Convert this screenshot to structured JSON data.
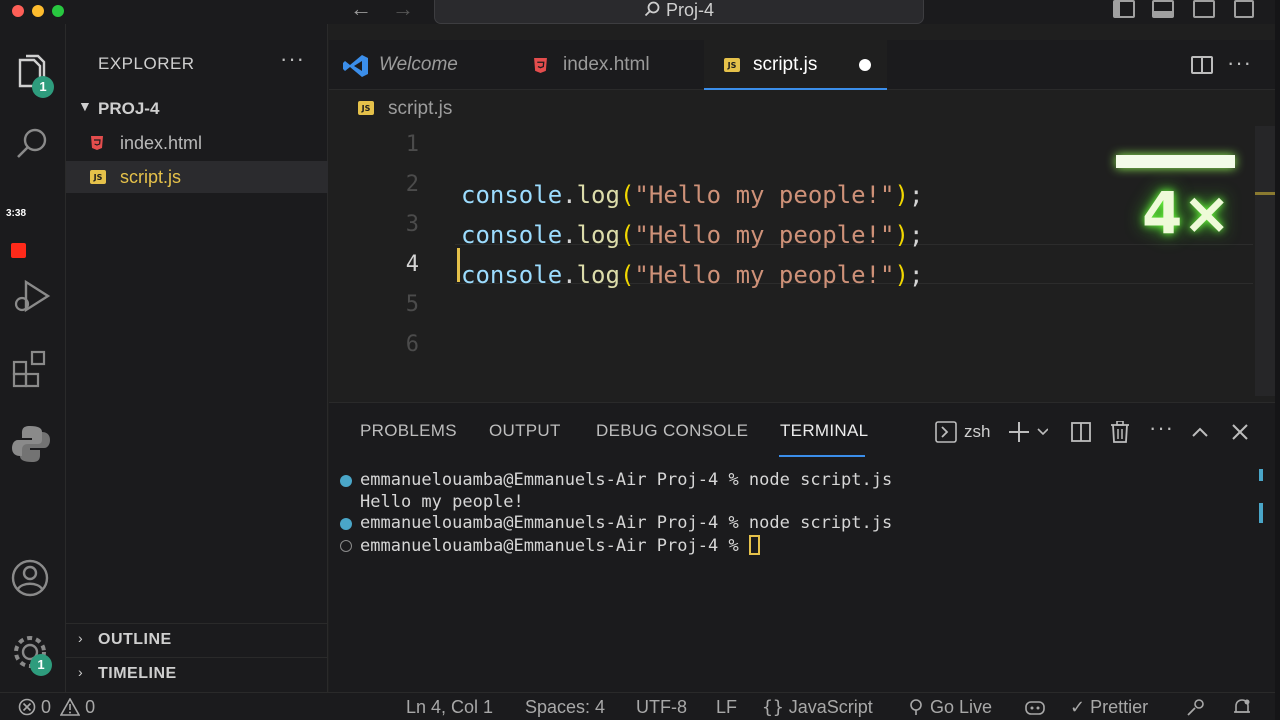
{
  "window": {
    "search_label": "Proj-4"
  },
  "activity_bar": {
    "explorer_badge": "1",
    "timer": "3:38",
    "settings_badge": "1"
  },
  "sidebar": {
    "title": "EXPLORER",
    "more": "···",
    "folder": "PROJ-4",
    "files": [
      {
        "name": "index.html",
        "type": "html"
      },
      {
        "name": "script.js",
        "type": "js"
      }
    ],
    "sections": [
      "OUTLINE",
      "TIMELINE"
    ]
  },
  "tabs": [
    {
      "label": "Welcome",
      "icon": "vscode-icon"
    },
    {
      "label": "index.html",
      "icon": "html-icon"
    },
    {
      "label": "script.js",
      "icon": "js-icon",
      "dirty": true
    }
  ],
  "editor": {
    "js_icon_text": "JS",
    "breadcrumb": "script.js",
    "line_numbers": [
      "1",
      "2",
      "3",
      "4",
      "5",
      "6"
    ],
    "active_line": "4",
    "code": {
      "obj": "console",
      "dot": ".",
      "fn": "log",
      "open": "(",
      "str": "\"Hello my people!\"",
      "close": ")",
      "semi": ";"
    },
    "playback_speed": "4×"
  },
  "panel": {
    "tabs": [
      "PROBLEMS",
      "OUTPUT",
      "DEBUG CONSOLE",
      "TERMINAL"
    ],
    "active_tab": "TERMINAL",
    "shell": "zsh",
    "terminal_lines": [
      {
        "text": "emmanuelouamba@Emmanuels-Air Proj-4 % node script.js",
        "dot": "filled"
      },
      {
        "text": "Hello my people!",
        "dot": "none"
      },
      {
        "text": "emmanuelouamba@Emmanuels-Air Proj-4 % node script.js",
        "dot": "filled"
      },
      {
        "text": "emmanuelouamba@Emmanuels-Air Proj-4 % ",
        "dot": "hollow"
      }
    ]
  },
  "statusbar": {
    "errors": "0",
    "warnings": "0",
    "position": "Ln 4, Col 1",
    "spaces": "Spaces: 4",
    "encoding": "UTF-8",
    "eol": "LF",
    "language": "JavaScript",
    "golive": "Go Live",
    "prettier": "Prettier"
  },
  "colors": {
    "accent": "#3b8eea",
    "badge": "#2e9c7d",
    "js_yellow": "#e5c14a",
    "html_red": "#e44d4d",
    "speed_glow": "#6aff3c"
  }
}
